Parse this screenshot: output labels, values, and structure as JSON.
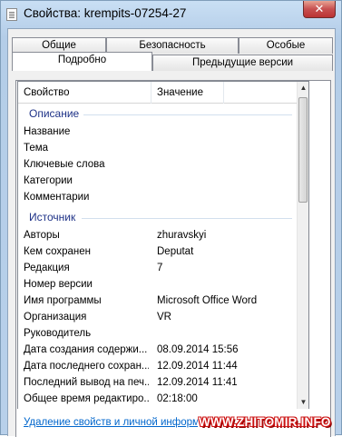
{
  "window": {
    "title": "Свойства: krempits-07254-27",
    "close_label": "✕"
  },
  "tabs": {
    "row1": [
      "Общие",
      "Безопасность",
      "Особые"
    ],
    "row2": [
      "Подробно",
      "Предыдущие версии"
    ],
    "selected": "Подробно"
  },
  "list": {
    "columns": [
      "Свойство",
      "Значение"
    ],
    "groups": [
      {
        "title": "Описание",
        "rows": [
          {
            "key": "Название",
            "value": ""
          },
          {
            "key": "Тема",
            "value": ""
          },
          {
            "key": "Ключевые слова",
            "value": ""
          },
          {
            "key": "Категории",
            "value": ""
          },
          {
            "key": "Комментарии",
            "value": ""
          }
        ]
      },
      {
        "title": "Источник",
        "rows": [
          {
            "key": "Авторы",
            "value": "zhuravskyi"
          },
          {
            "key": "Кем сохранен",
            "value": "Deputat"
          },
          {
            "key": "Редакция",
            "value": "7"
          },
          {
            "key": "Номер версии",
            "value": ""
          },
          {
            "key": "Имя программы",
            "value": "Microsoft Office Word"
          },
          {
            "key": "Организация",
            "value": "VR"
          },
          {
            "key": "Руководитель",
            "value": ""
          },
          {
            "key": "Дата создания содержи...",
            "value": "08.09.2014 15:56"
          },
          {
            "key": "Дата последнего сохран...",
            "value": "12.09.2014 11:44"
          },
          {
            "key": "Последний вывод на печ...",
            "value": "12.09.2014 11:41"
          },
          {
            "key": "Общее время редактиро...",
            "value": "02:18:00"
          }
        ]
      }
    ]
  },
  "footer": {
    "link": "Удаление свойств и личной информа"
  },
  "watermark": "WWW.ZHITOMIR.INFO"
}
